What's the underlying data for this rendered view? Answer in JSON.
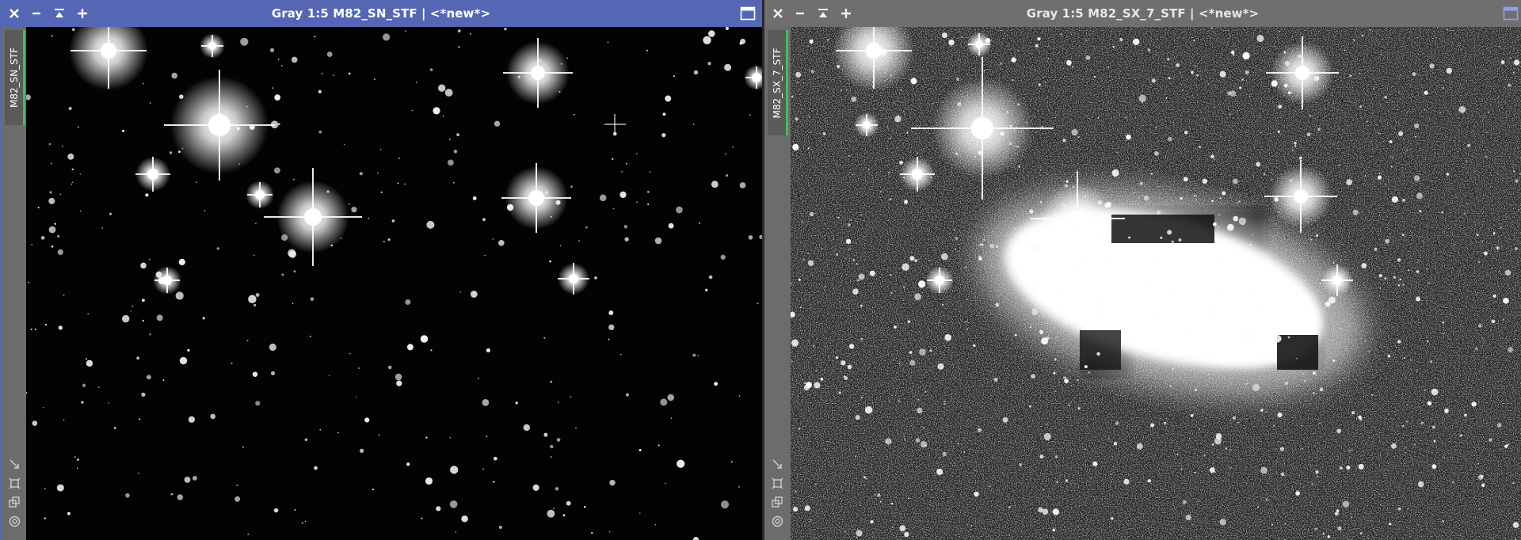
{
  "windows": [
    {
      "title": "Gray 1:5 M82_SN_STF | <*new*>",
      "view_tab": "M82_SN_STF",
      "active": true,
      "colors": {
        "titlebar": "#5567b4",
        "tab_indicator": "#3fbf5a"
      },
      "icons": [
        "close-icon",
        "minimize-icon",
        "shade-icon",
        "maximize-plus-icon",
        "maximize-icon"
      ],
      "side_icons": [
        "fit-view-icon",
        "zoom-window-icon",
        "clone-icon",
        "target-icon"
      ]
    },
    {
      "title": "Gray 1:5 M82_SX_7_STF | <*new*>",
      "view_tab": "M82_SX_7_STF",
      "active": false,
      "colors": {
        "titlebar": "#6f6f6f",
        "tab_indicator": "#3fbf5a"
      },
      "icons": [
        "close-icon",
        "minimize-icon",
        "shade-icon",
        "maximize-plus-icon",
        "maximize-icon"
      ],
      "side_icons": [
        "fit-view-icon",
        "zoom-window-icon",
        "clone-icon",
        "target-icon"
      ]
    }
  ]
}
